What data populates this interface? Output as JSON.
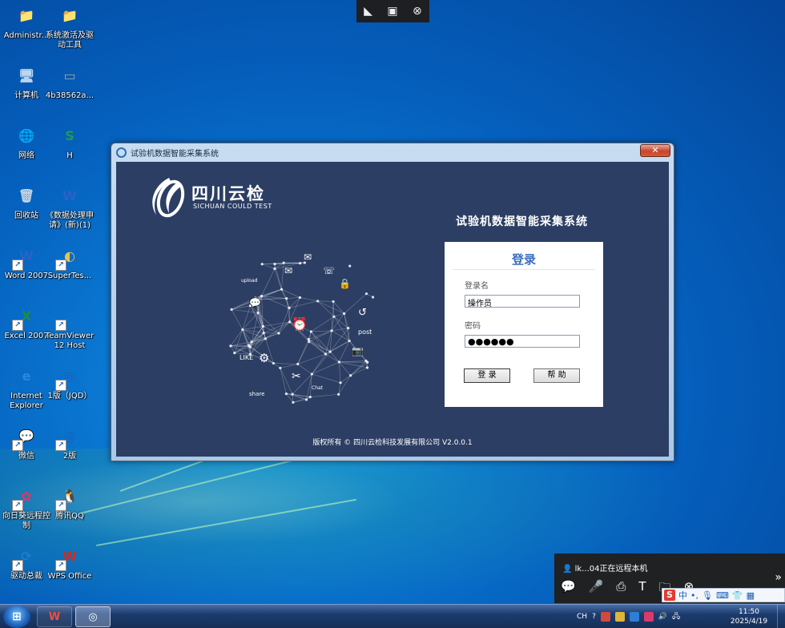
{
  "desktop": {
    "icons": [
      {
        "label": "Administr...",
        "glyph": "📁",
        "color": "#e8c24a"
      },
      {
        "label": "系统激活及驱动工具",
        "glyph": "📁",
        "color": "#e8c24a"
      },
      {
        "label": "计算机",
        "glyph": "🖥",
        "color": "#bcd6ef"
      },
      {
        "label": "4b38562a...",
        "glyph": "▭",
        "color": "#9aa4ad"
      },
      {
        "label": "网络",
        "glyph": "🌐",
        "color": "#3a9b3a"
      },
      {
        "label": "H",
        "glyph": "S",
        "color": "#1e9b55"
      },
      {
        "label": "回收站",
        "glyph": "🗑",
        "color": "#c9d7e4"
      },
      {
        "label": "《数据处理申请》(新)(1)",
        "glyph": "W",
        "color": "#2a63c6"
      },
      {
        "label": "Word 2007",
        "glyph": "W",
        "color": "#2a63c6"
      },
      {
        "label": "SuperTes...",
        "glyph": "◐",
        "color": "#e8c24a"
      },
      {
        "label": "Excel 2007",
        "glyph": "X",
        "color": "#1e8e3e"
      },
      {
        "label": "TeamViewer 12 Host",
        "glyph": "⇆",
        "color": "#0e6fd0"
      },
      {
        "label": "Internet Explorer",
        "glyph": "e",
        "color": "#2a8ae0"
      },
      {
        "label": "1版（JQD）",
        "glyph": "◎",
        "color": "#1a5fb4"
      },
      {
        "label": "微信",
        "glyph": "💬",
        "color": "#2fbd3c"
      },
      {
        "label": "2版",
        "glyph": "◎",
        "color": "#1a5fb4"
      },
      {
        "label": "向日葵远程控制",
        "glyph": "✿",
        "color": "#e8335b"
      },
      {
        "label": "腾讯QQ",
        "glyph": "🐧",
        "color": "#222222"
      },
      {
        "label": "驱动总裁",
        "glyph": "⟳",
        "color": "#1a7fd0"
      },
      {
        "label": "WPS Office",
        "glyph": "W",
        "color": "#d6281e"
      }
    ]
  },
  "remote_bar": {
    "icons": [
      "pointer-icon",
      "screen-icon",
      "close-icon"
    ]
  },
  "window": {
    "title": "试验机数据智能采集系统",
    "close_label": "✕",
    "logo": {
      "cn": "四川云检",
      "en": "SICHUAN COULD TEST"
    },
    "system_title": "试验机数据智能采集系统",
    "login": {
      "heading": "登录",
      "username_label": "登录名",
      "username_value": "操作员",
      "password_label": "密码",
      "password_value": "●●●●●●",
      "login_button": "登 录",
      "help_button": "帮 助"
    },
    "copyright": "版权所有 © 四川云检科技发展有限公司 V2.0.0.1"
  },
  "remote_panel": {
    "status": "lk...04正在远程本机",
    "expand": "»"
  },
  "ime": {
    "lang": "中"
  },
  "taskbar": {
    "tray_lang": "CH",
    "time": "11:50",
    "date": "2025/4/19"
  }
}
